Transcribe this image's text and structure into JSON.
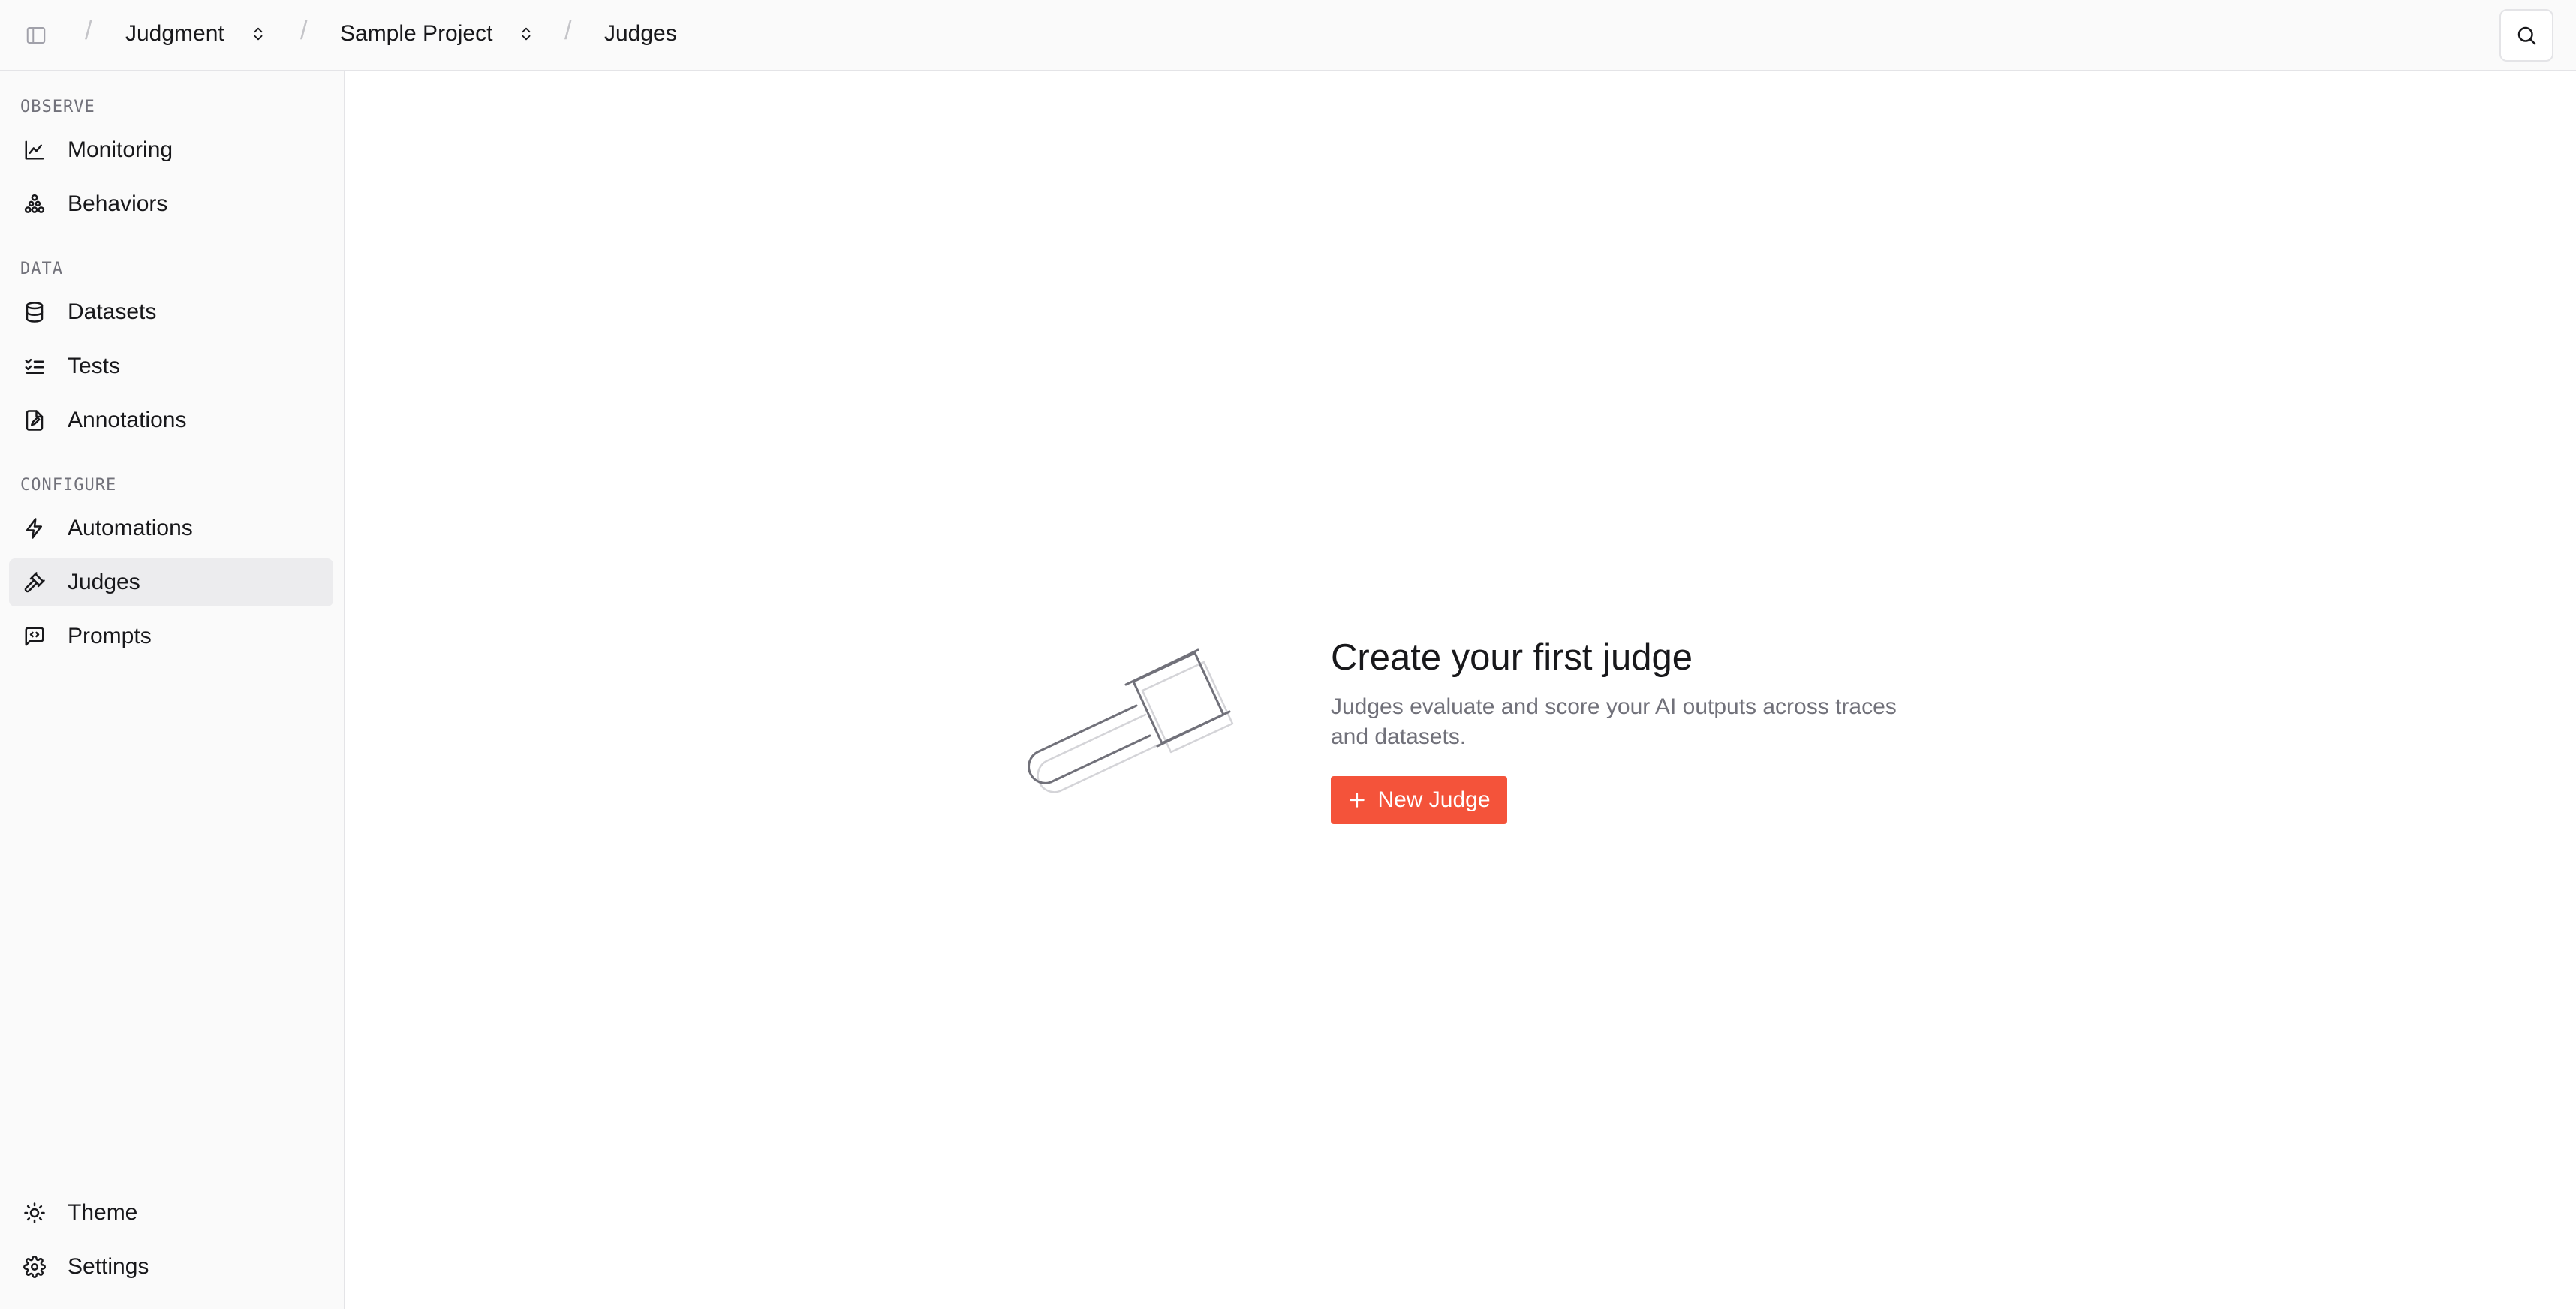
{
  "breadcrumb": {
    "org": "Judgment",
    "project": "Sample Project",
    "page": "Judges"
  },
  "sidebar": {
    "sections": [
      {
        "label": "OBSERVE",
        "items": [
          {
            "label": "Monitoring",
            "icon": "chart-line-icon"
          },
          {
            "label": "Behaviors",
            "icon": "nodes-icon"
          }
        ]
      },
      {
        "label": "DATA",
        "items": [
          {
            "label": "Datasets",
            "icon": "database-icon"
          },
          {
            "label": "Tests",
            "icon": "checklist-icon"
          },
          {
            "label": "Annotations",
            "icon": "file-pen-icon"
          }
        ]
      },
      {
        "label": "CONFIGURE",
        "items": [
          {
            "label": "Automations",
            "icon": "zap-icon"
          },
          {
            "label": "Judges",
            "icon": "gavel-icon",
            "active": true
          },
          {
            "label": "Prompts",
            "icon": "message-code-icon"
          }
        ]
      }
    ],
    "footer": [
      {
        "label": "Theme",
        "icon": "sun-icon"
      },
      {
        "label": "Settings",
        "icon": "gear-icon"
      }
    ]
  },
  "empty_state": {
    "title": "Create your first judge",
    "description": "Judges evaluate and score your AI outputs across traces and datasets.",
    "button_label": "New Judge",
    "illustration": "gavel-illustration"
  },
  "colors": {
    "accent": "#f4533a",
    "sidebar_bg": "#fafafa",
    "active_item_bg": "#ececee",
    "muted_text": "#71717a"
  }
}
